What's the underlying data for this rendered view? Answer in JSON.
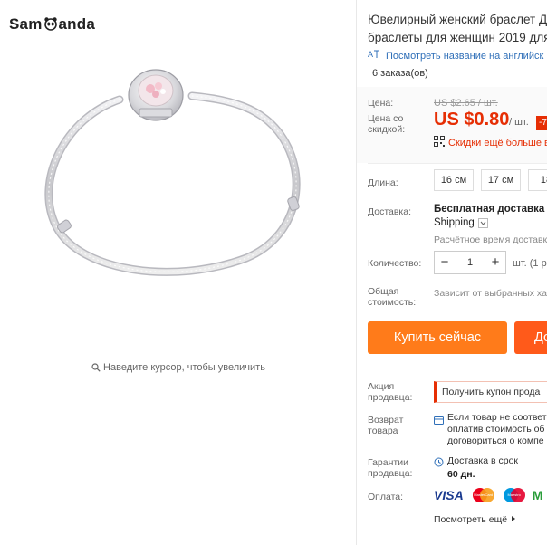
{
  "brand": {
    "left": "Sam",
    "right": "anda",
    "logo_icon": "panda-icon"
  },
  "gallery": {
    "zoom_hint": "Наведите курсор, чтобы увеличить"
  },
  "product": {
    "title_line1": "Ювелирный женский браслет Де",
    "title_line2": "браслеты для женщин 2019 для б",
    "translate_link": "Посмотреть название на английск",
    "orders": "6 заказа(ов)"
  },
  "price": {
    "label": "Цена:",
    "old": "US $2.65 / шт.",
    "sale_label_line1": "Цена со",
    "sale_label_line2": "скидкой:",
    "new": "US $0.80",
    "unit": "/ шт.",
    "discount": "-7",
    "coupon_text": "Скидки ещё больше в"
  },
  "length": {
    "label": "Длина:",
    "options": [
      "16 см",
      "17 см",
      "18"
    ]
  },
  "shipping": {
    "label": "Доставка:",
    "title": "Бесплатная доставка в I",
    "method": "Shipping",
    "time": "Расчётное время доставк"
  },
  "quantity": {
    "label": "Количество:",
    "value": "1",
    "minus": "−",
    "plus": "+",
    "unit": "шт. (1 р"
  },
  "total": {
    "label_line1": "Общая",
    "label_line2": "стоимость:",
    "value": "Зависит от выбранных ха"
  },
  "actions": {
    "buy_now": "Купить сейчас",
    "add_to_cart": "До"
  },
  "promo": {
    "label_line1": "Акция",
    "label_line2": "продавца:",
    "coupon": "Получить купон прода"
  },
  "returns": {
    "label_line1": "Возврат",
    "label_line2": "товара",
    "line1": "Если товар не соответ",
    "line2": "оплатив стоимость об",
    "line3": "договориться о компе"
  },
  "guarantee": {
    "label_line1": "Гарантии",
    "label_line2": "продавца:",
    "text": "Доставка в срок",
    "days": "60 дн."
  },
  "payment": {
    "label": "Оплата:",
    "visa": "VISA",
    "mastercard": "MasterCard",
    "maestro": "Maestro",
    "third": "M"
  },
  "see_more": "Посмотреть ещё",
  "colors": {
    "accent": "#e62e04",
    "buy": "#ff7b1a",
    "cart": "#ff5a1a",
    "link": "#2f6fb8"
  }
}
